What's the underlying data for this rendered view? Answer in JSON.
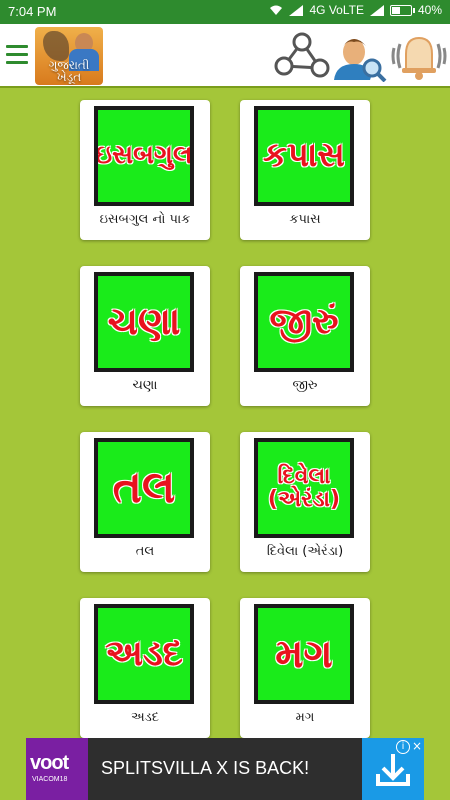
{
  "status": {
    "time": "7:04 PM",
    "network": "4G VoLTE",
    "battery": "40%"
  },
  "header": {
    "logo_text": "ગુજરાતી ખેડૂત",
    "icons": [
      "share-icon",
      "user-search-icon",
      "bell-icon"
    ]
  },
  "crops": [
    {
      "tile": "ઇસબગુલ",
      "label": "ઇસબગુલ નો પાક"
    },
    {
      "tile": "કપાસ",
      "label": "કપાસ"
    },
    {
      "tile": "ચણા",
      "label": "ચણા"
    },
    {
      "tile": "જીરું",
      "label": "જીરુ"
    },
    {
      "tile": "તલ",
      "label": "તલ"
    },
    {
      "tile_line1": "દિવેલા",
      "tile_line2": "(એરંડા)",
      "label": "દિવેલા (એરંડા)"
    },
    {
      "tile": "અડદ",
      "label": "અડદ"
    },
    {
      "tile": "મગ",
      "label": "મગ"
    }
  ],
  "ad": {
    "logo": "voot",
    "logo_sub": "VIACOM18",
    "text": "SPLITSVILLA X IS BACK!",
    "info": "i",
    "close": "×"
  },
  "colors": {
    "background": "#a4c639",
    "status_bar": "#2e8b2e",
    "tile_green": "#1aeb1a",
    "tile_text_red": "#e8121e"
  }
}
